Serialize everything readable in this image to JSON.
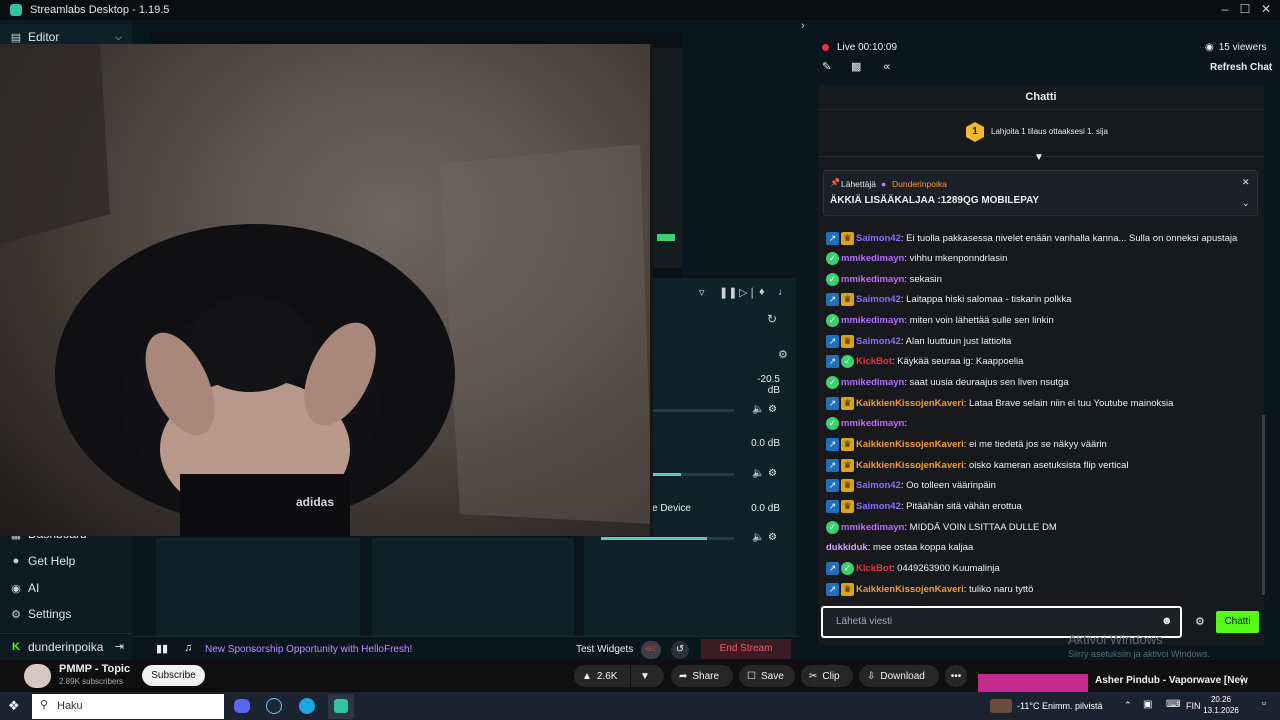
{
  "window": {
    "title": "Streamlabs Desktop - 1.19.5"
  },
  "sidebar": {
    "editor_label": "Editor",
    "items": [
      {
        "label": "Dashboard",
        "icon": "dashboard-icon"
      },
      {
        "label": "Get Help",
        "icon": "help-icon"
      },
      {
        "label": "AI",
        "icon": "eye-icon"
      },
      {
        "label": "Settings",
        "icon": "gear-icon"
      }
    ],
    "account_label": "dunderinpoika"
  },
  "mixer": {
    "values": [
      "-20.5 dB",
      "0.0 dB",
      "0.0 dB"
    ],
    "device_label": "e Device",
    "volume_levels": [
      0.2,
      0.6,
      0.8
    ]
  },
  "footer": {
    "sponsor_text": "New Sponsorship Opportunity with HelloFresh!",
    "test_widgets": "Test Widgets",
    "rec_label": "REC",
    "end_stream": "End Stream"
  },
  "stream": {
    "status": "Live 00:10:09",
    "viewers": "15 viewers",
    "refresh_chat": "Refresh Chat"
  },
  "chat": {
    "title": "Chatti",
    "gift_text": "Lahjoita 1 tilaus ottaaksesi 1. sija",
    "gift_rank": "1",
    "pinned_by_label": "Lähettäjä",
    "pinned_user": "Dunderinpoika",
    "pinned_message": "ÄKKIÄ LISÄÄKALJAA :1289QG MOBILEPAY",
    "messages": [
      {
        "user": "Saimon42",
        "text": ": Ei tuolla pakkasessa nivelet enään vanhalla kanna... Sulla on onneksi apustaja",
        "color": "#8a6cff",
        "badges": [
          "sub",
          "crown"
        ]
      },
      {
        "user": "mmikedimayn",
        "text": ": vihhu mkenponndrlasin",
        "color": "#b56cff",
        "badges": [
          "ok"
        ]
      },
      {
        "user": "mmikedimayn",
        "text": ": sekasin",
        "color": "#b56cff",
        "badges": [
          "ok"
        ]
      },
      {
        "user": "Saimon42",
        "text": ": Laitappa hiski salomaa - tiskarin polkka",
        "color": "#8a6cff",
        "badges": [
          "sub",
          "crown"
        ]
      },
      {
        "user": "mmikedimayn",
        "text": ": miten voin lähettää sulle sen linkin",
        "color": "#b56cff",
        "badges": [
          "ok"
        ]
      },
      {
        "user": "Saimon42",
        "text": ": Alan luuttuun just lattiolta",
        "color": "#8a6cff",
        "badges": [
          "sub",
          "crown"
        ]
      },
      {
        "user": "KickBot",
        "text": ": Käykää seuraa ig: Kaappoelia",
        "color": "#e8323c",
        "badges": [
          "sub",
          "ok"
        ]
      },
      {
        "user": "mmikedimayn",
        "text": ": saat uusia deuraajus sen liven nsutga",
        "color": "#b56cff",
        "badges": [
          "ok"
        ]
      },
      {
        "user": "KaikkienKissojenKaveri",
        "text": ": Lataa Brave selain niin ei tuu Youtube mainoksia",
        "color": "#f29a3a",
        "badges": [
          "sub",
          "crown"
        ]
      },
      {
        "user": "mmikedimayn",
        "text": ":",
        "color": "#b56cff",
        "badges": [
          "ok"
        ]
      },
      {
        "user": "KaikkienKissojenKaveri",
        "text": ": ei me tiedetä jos se näkyy väärin",
        "color": "#f29a3a",
        "badges": [
          "sub",
          "crown"
        ]
      },
      {
        "user": "KaikkienKissojenKaveri",
        "text": ": oisko kameran asetuksista flip vertical",
        "color": "#f29a3a",
        "badges": [
          "sub",
          "crown"
        ]
      },
      {
        "user": "Saimon42",
        "text": ": Oo tolleen väärinpäin",
        "color": "#8a6cff",
        "badges": [
          "sub",
          "crown"
        ]
      },
      {
        "user": "Saimon42",
        "text": ": Pitäähän sitä vähän erottua",
        "color": "#8a6cff",
        "badges": [
          "sub",
          "crown"
        ]
      },
      {
        "user": "mmikedimayn",
        "text": ": MIDDÄ VOIN LSITTAA DULLE DM",
        "color": "#b56cff",
        "badges": [
          "ok"
        ]
      },
      {
        "user": "dukkiduk",
        "text": ": mee ostaa koppa kaljaa",
        "color": "#d6a0ff",
        "badges": []
      },
      {
        "user": "KickBot",
        "text": ": 0449263900 Kuumalinja",
        "color": "#e8323c",
        "badges": [
          "sub",
          "ok"
        ]
      },
      {
        "user": "KaikkienKissojenKaveri",
        "text": ": tuliko naru tyttö",
        "color": "#f29a3a",
        "badges": [
          "sub",
          "crown"
        ]
      }
    ],
    "input_placeholder": "Lähetä viesti",
    "send_label": "Chatti"
  },
  "watermark": {
    "line1": "Aktivoi Windows",
    "line2": "Siirry asetuksiin ja aktivoi Windows."
  },
  "youtube": {
    "channel": "PMMP - Topic",
    "subscribers": "2.89K subscribers",
    "subscribe": "Subscribe",
    "likes": "2.6K",
    "share": "Share",
    "save": "Save",
    "clip": "Clip",
    "download": "Download",
    "more": "•••",
    "next_title": "Asher Pindub - Vaporwave [New"
  },
  "taskbar": {
    "search": "Haku",
    "weather": "-11°C  Enimm. pilvistä",
    "lang": "FIN",
    "time": "20.26",
    "date": "13.1.2026"
  }
}
